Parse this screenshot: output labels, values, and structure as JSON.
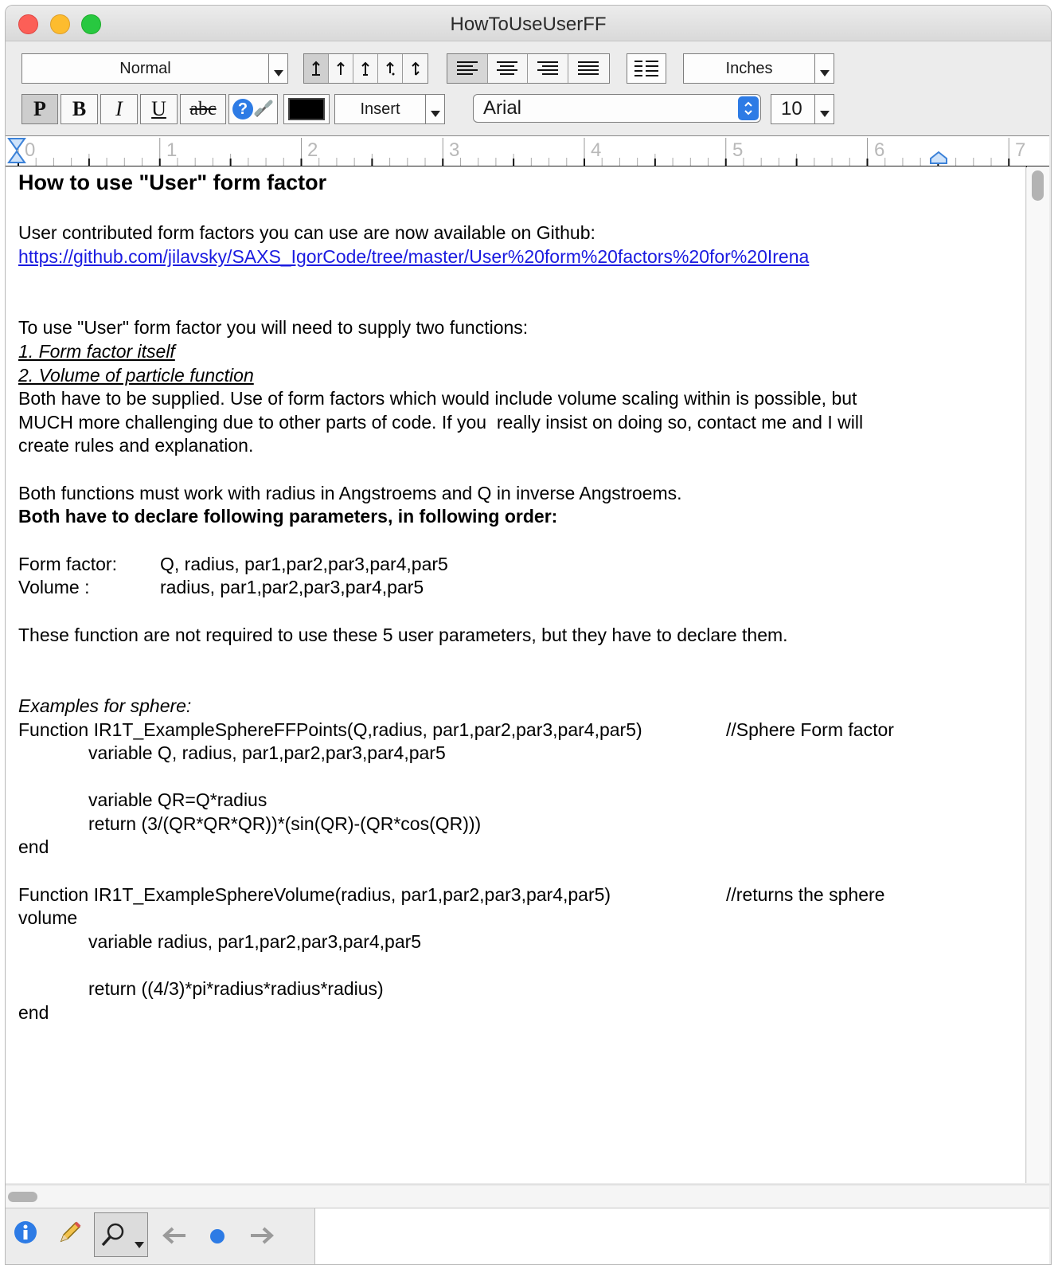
{
  "window": {
    "title": "HowToUseUserFF"
  },
  "toolbar": {
    "style_select": "Normal",
    "units_select": "Inches",
    "insert_select": "Insert",
    "font_select": "Arial",
    "size_select": "10",
    "format_P": "P",
    "format_B": "B",
    "format_I": "I",
    "format_U": "U",
    "format_strike": "abc",
    "help_glyph": "?"
  },
  "ruler": {
    "labels": [
      "0",
      "1",
      "2",
      "3",
      "4",
      "5",
      "6",
      "7"
    ]
  },
  "doc": {
    "heading": "How to use \"User\" form factor",
    "intro": "User contributed form factors you can use are now available on Github:",
    "link": "https://github.com/jilavsky/SAXS_IgorCode/tree/master/User%20form%20factors%20for%20Irena",
    "para1": "To use \"User\" form factor you will need to supply two functions:",
    "item1": "1. Form factor itself",
    "item2": "2. Volume of particle function",
    "para2_l1": "Both have to be supplied. Use of form factors which would include volume scaling within is possible, but",
    "para2_l2": "MUCH more challenging due to other parts of code. If you  really insist on doing so, contact me and I will",
    "para2_l3": "create rules and explanation.",
    "para3": "Both functions must work with radius in Angstroems and Q in inverse Angstroems.",
    "para4_bold": "Both have to declare following parameters, in following order:",
    "ff_label": "Form factor:",
    "ff_params": "Q, radius, par1,par2,par3,par4,par5",
    "vol_label": "Volume :",
    "vol_params": "radius, par1,par2,par3,par4,par5",
    "para5": "These function are not required to use these 5 user parameters, but they have to declare them.",
    "examples": "Examples for sphere:",
    "fn1_sig": "Function IR1T_ExampleSphereFFPoints(Q,radius, par1,par2,par3,par4,par5)",
    "fn1_comment": "//Sphere Form factor",
    "fn1_var": "variable Q, radius, par1,par2,par3,par4,par5",
    "fn1_qr": "variable QR=Q*radius",
    "fn1_ret": "return (3/(QR*QR*QR))*(sin(QR)-(QR*cos(QR)))",
    "fn1_end": "end",
    "fn2_sig": "Function IR1T_ExampleSphereVolume(radius, par1,par2,par3,par4,par5)",
    "fn2_comment": "//returns the sphere",
    "fn2_wrap": "volume",
    "fn2_var": "variable radius, par1,par2,par3,par4,par5",
    "fn2_ret": "return ((4/3)*pi*radius*radius*radius)",
    "fn2_end": "end"
  },
  "colors": {
    "link": "#1a1ae0",
    "close": "#fc5f57",
    "minimize": "#fdbc2e",
    "maximize": "#28c840",
    "accent": "#2d7be5"
  }
}
